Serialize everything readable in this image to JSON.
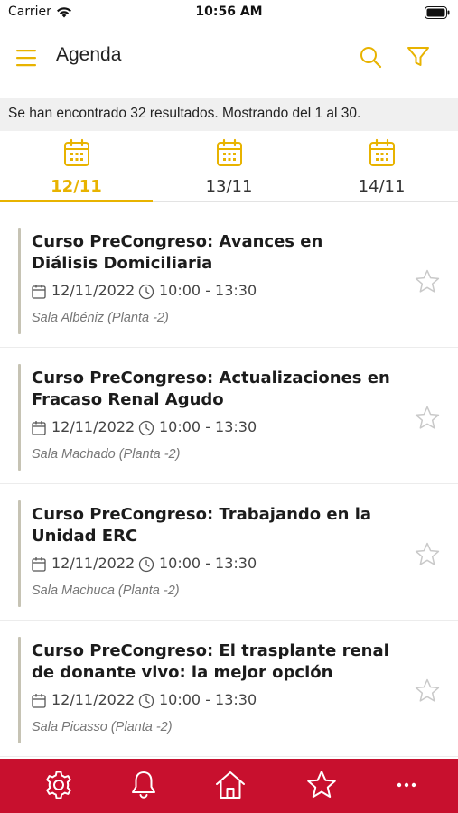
{
  "status_bar": {
    "carrier": "Carrier",
    "time": "10:56 AM"
  },
  "header": {
    "title": "Agenda"
  },
  "results": {
    "text": "Se han encontrado 32 resultados. Mostrando del 1 al 30."
  },
  "tabs": [
    {
      "label": "12/11",
      "active": true
    },
    {
      "label": "13/11",
      "active": false
    },
    {
      "label": "14/11",
      "active": false
    }
  ],
  "events": [
    {
      "title": "Curso PreCongreso: Avances en Diálisis Domiciliaria",
      "date": "12/11/2022",
      "time": "10:00 - 13:30",
      "location": "Sala Albéniz (Planta -2)"
    },
    {
      "title": "Curso PreCongreso: Actualizaciones en Fracaso Renal Agudo",
      "date": "12/11/2022",
      "time": "10:00 - 13:30",
      "location": "Sala Machado (Planta -2)"
    },
    {
      "title": "Curso PreCongreso: Trabajando en la Unidad ERC",
      "date": "12/11/2022",
      "time": "10:00 - 13:30",
      "location": "Sala Machuca (Planta -2)"
    },
    {
      "title": "Curso PreCongreso: El trasplante renal de donante vivo: la mejor opción",
      "date": "12/11/2022",
      "time": "10:00 - 13:30",
      "location": "Sala Picasso (Planta -2)"
    }
  ],
  "bottom_nav": [
    {
      "icon": "gear-icon"
    },
    {
      "icon": "bell-icon"
    },
    {
      "icon": "home-icon"
    },
    {
      "icon": "star-icon"
    },
    {
      "icon": "more-icon"
    }
  ],
  "colors": {
    "accent": "#e8b300",
    "nav_background": "#c8102e",
    "results_background": "#f0f0f0",
    "event_bar": "#c6c3b4"
  }
}
